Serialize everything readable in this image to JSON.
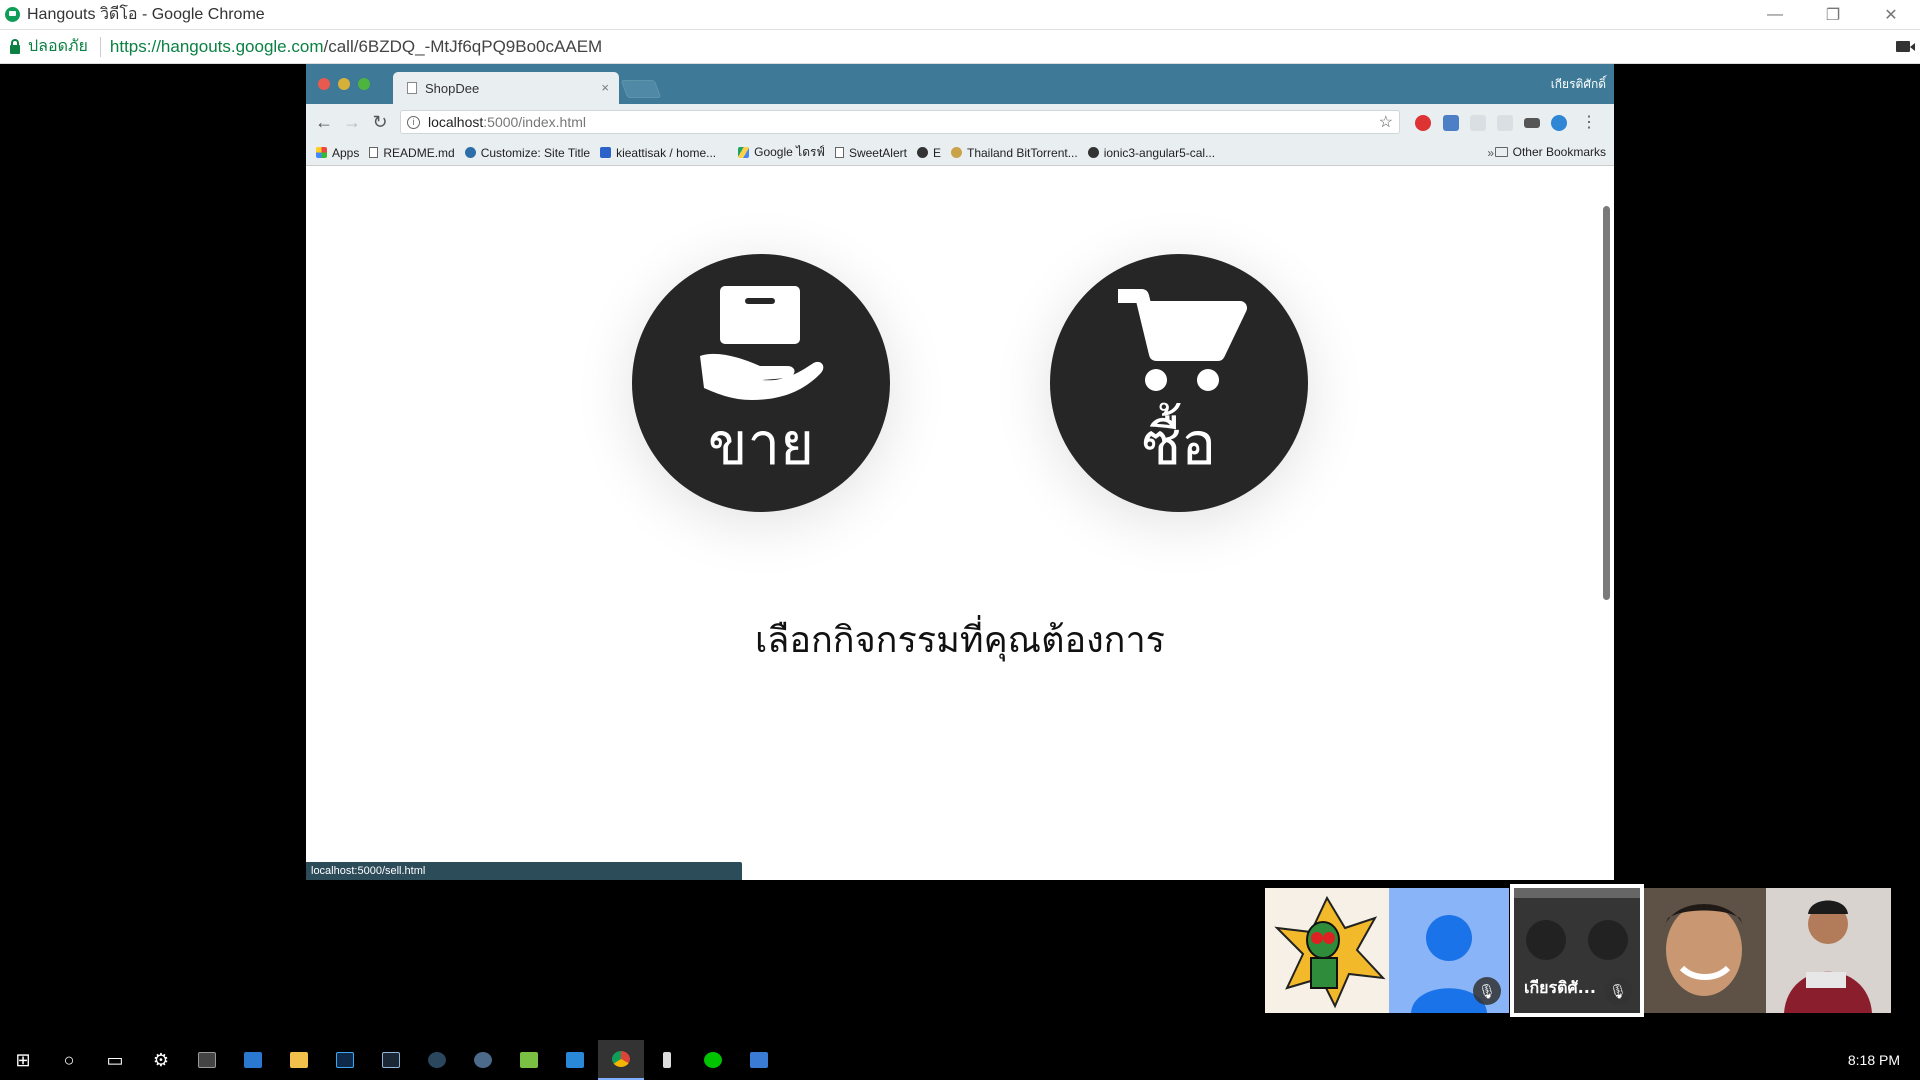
{
  "window": {
    "title": "Hangouts วิดีโอ - Google Chrome",
    "controls": [
      "—",
      "❐",
      "✕"
    ]
  },
  "addressbar": {
    "secure_label": "ปลอดภัย",
    "url_host": "https://hangouts.google.com",
    "url_path": "/call/6BZDQ_-MtJf6qPQ9Bo0cAAEM"
  },
  "shared_screen": {
    "tab_title": "ShopDee",
    "tab_close": "×",
    "user_label": "เกียรติศักดิ์",
    "nav": {
      "back": "←",
      "forward": "→",
      "reload": "↻"
    },
    "omnibox": {
      "host": "localhost",
      "path": ":5000/index.html",
      "star": "☆"
    },
    "kebab": "⋮",
    "bookmarks": [
      {
        "label": "Apps",
        "icon": "apps-grid-icon"
      },
      {
        "label": "README.md",
        "icon": "doc-icon"
      },
      {
        "label": "Customize: Site Title",
        "icon": "wordpress-icon"
      },
      {
        "label": "kieattisak / home...",
        "icon": "blue-square-icon"
      },
      {
        "label": "Google ไดรฟ์",
        "icon": "drive-icon"
      },
      {
        "label": "SweetAlert",
        "icon": "doc-icon"
      },
      {
        "label": "E",
        "icon": "github-icon"
      },
      {
        "label": "Thailand BitTorrent...",
        "icon": "torrent-icon"
      },
      {
        "label": "ionic3-angular5-cal...",
        "icon": "github-icon"
      }
    ],
    "bookmarks_more": "»",
    "other_bookmarks": "Other Bookmarks",
    "sell_label": "ขาย",
    "buy_label": "ซื้อ",
    "heading": "เลือกกิจกรรมที่คุณต้องการ",
    "status_url": "localhost:5000/sell.html"
  },
  "participants": [
    {
      "kind": "avatar-image"
    },
    {
      "kind": "placeholder",
      "muted": true
    },
    {
      "kind": "screen-share",
      "name": "เกียรติศั...",
      "muted": true
    },
    {
      "kind": "camera"
    },
    {
      "kind": "camera"
    }
  ],
  "taskbar": {
    "clock": "8:18 PM"
  }
}
